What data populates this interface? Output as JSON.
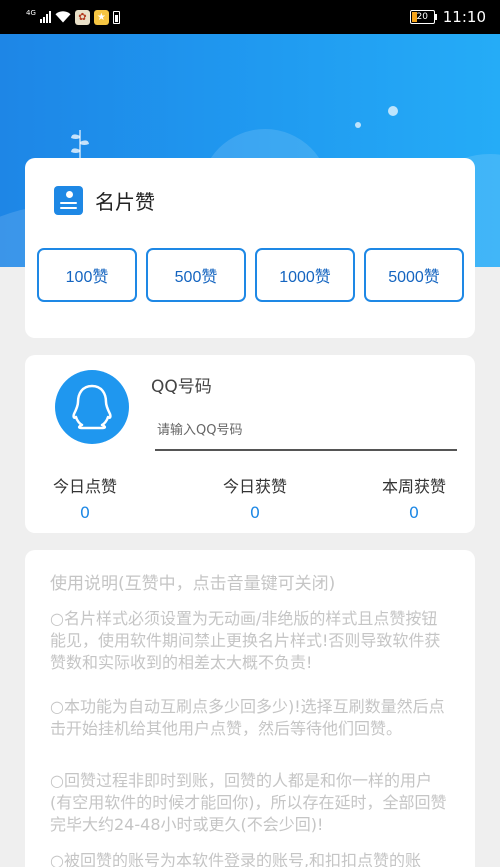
{
  "status_bar": {
    "network": "4G",
    "icons": [
      "signal-icon",
      "wifi-icon",
      "app-icon-1",
      "app-icon-2",
      "phone-battery-icon"
    ],
    "battery": "20",
    "time": "11:10"
  },
  "colors": {
    "primary": "#1e88e5",
    "header_gradient_start": "#1e86e6",
    "header_gradient_end": "#25acf7"
  },
  "name_card": {
    "title": "名片赞",
    "icon": "card-icon",
    "buttons": [
      {
        "label": "100赞"
      },
      {
        "label": "500赞"
      },
      {
        "label": "1000赞"
      },
      {
        "label": "5000赞"
      }
    ]
  },
  "qq_panel": {
    "avatar_icon": "qq-penguin-icon",
    "label": "QQ号码",
    "input_placeholder": "请输入QQ号码",
    "input_value": "",
    "stats": [
      {
        "label": "今日点赞",
        "value": "0"
      },
      {
        "label": "今日获赞",
        "value": "0"
      },
      {
        "label": "本周获赞",
        "value": "0"
      }
    ]
  },
  "instructions": {
    "title": "使用说明(互赞中，点击音量键可关闭)",
    "paragraphs": [
      "○名片样式必须设置为无动画/非绝版的样式且点赞按钮能见，使用软件期间禁止更换名片样式!否则导致软件获赞数和实际收到的相差太大概不负责!",
      "○本功能为自动互刷点多少回多少)!选择互刷数量然后点击开始挂机给其他用户点赞，然后等待他们回赞。",
      "○回赞过程非即时到账，回赞的人都是和你一样的用户(有空用软件的时候才能回你)，所以存在延时，全部回赞完毕大约24-48小时或更久(不会少回)!",
      "○被回赞的账号为本软件登录的账号,和扣扣点赞的账"
    ]
  }
}
